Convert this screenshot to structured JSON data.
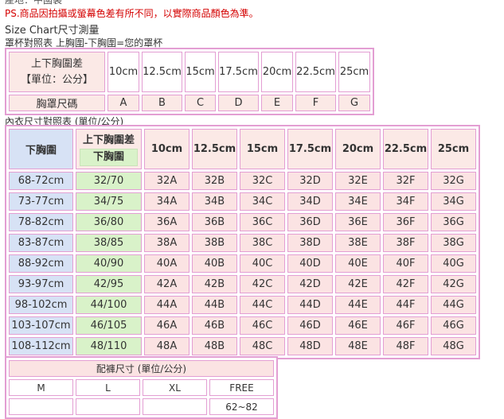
{
  "header": {
    "cut_line": "產地：中國製",
    "ps_note": "PS.商品因拍攝或螢幕色差有所不同，以實際商品顏色為準。",
    "size_chart": "Size Chart尺寸測量",
    "cup_reference": "罩杯對照表 上胸圍-下胸圍=您的罩杯"
  },
  "cup_table": {
    "header_line1": "上下胸圍差",
    "header_line2": "【單位：公分】",
    "row_label": "胸罩尺碼",
    "diffs": [
      "10cm",
      "12.5cm",
      "15cm",
      "17.5cm",
      "20cm",
      "22.5cm",
      "25cm"
    ],
    "cups": [
      "A",
      "B",
      "C",
      "D",
      "E",
      "F",
      "G"
    ]
  },
  "bra_table": {
    "title": "內衣尺寸對照表 (單位/公分)",
    "col_under": "下胸圍",
    "col_diff_top": "上下胸圍差",
    "col_diff_bottom": "下胸圍",
    "diff_headers": [
      "10cm",
      "12.5cm",
      "15cm",
      "17.5cm",
      "20cm",
      "22.5cm",
      "25cm"
    ],
    "rows": [
      {
        "under": "68-72cm",
        "band": "32/70",
        "sizes": [
          "32A",
          "32B",
          "32C",
          "32D",
          "32E",
          "32F",
          "32G"
        ]
      },
      {
        "under": "73-77cm",
        "band": "34/75",
        "sizes": [
          "34A",
          "34B",
          "34C",
          "34D",
          "34E",
          "34F",
          "34G"
        ]
      },
      {
        "under": "78-82cm",
        "band": "36/80",
        "sizes": [
          "36A",
          "36B",
          "36C",
          "36D",
          "36E",
          "36F",
          "36G"
        ]
      },
      {
        "under": "83-87cm",
        "band": "38/85",
        "sizes": [
          "38A",
          "38B",
          "38C",
          "38D",
          "38E",
          "38F",
          "38G"
        ]
      },
      {
        "under": "88-92cm",
        "band": "40/90",
        "sizes": [
          "40A",
          "40B",
          "40C",
          "40D",
          "40E",
          "40F",
          "40G"
        ]
      },
      {
        "under": "93-97cm",
        "band": "42/95",
        "sizes": [
          "42A",
          "42B",
          "42C",
          "42D",
          "42E",
          "42F",
          "42G"
        ]
      },
      {
        "under": "98-102cm",
        "band": "44/100",
        "sizes": [
          "44A",
          "44B",
          "44C",
          "44D",
          "44E",
          "44F",
          "44G"
        ]
      },
      {
        "under": "103-107cm",
        "band": "46/105",
        "sizes": [
          "46A",
          "46B",
          "46C",
          "46D",
          "46E",
          "46F",
          "46G"
        ]
      },
      {
        "under": "108-112cm",
        "band": "48/110",
        "sizes": [
          "48A",
          "48B",
          "48C",
          "48D",
          "48E",
          "48F",
          "48G"
        ]
      }
    ]
  },
  "panty_table": {
    "title": "配褲尺寸 (單位/公分)",
    "sizes": [
      "M",
      "L",
      "XL",
      "FREE"
    ],
    "values": [
      "",
      "",
      "",
      "62~82"
    ]
  },
  "colors": {
    "border": "#e39ed3",
    "pink_cell": "#fbe9e6",
    "blue_cell": "#d7e2f5",
    "green_cell": "#d9f2c9",
    "ps_red": "#d40000"
  }
}
